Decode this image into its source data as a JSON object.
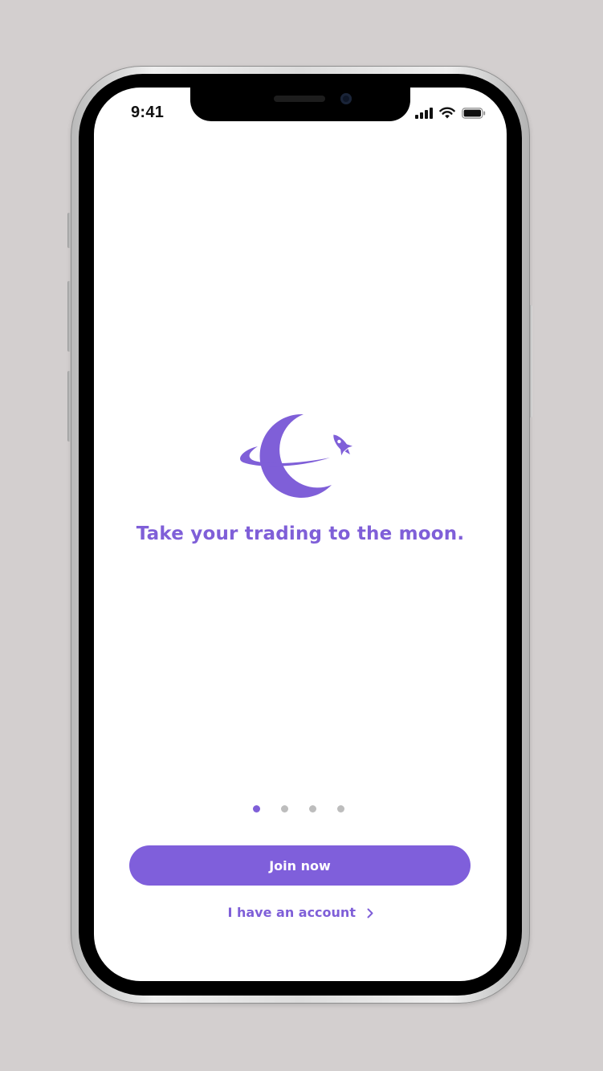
{
  "status_bar": {
    "time": "9:41",
    "icons": [
      "signal-icon",
      "wifi-icon",
      "battery-icon"
    ]
  },
  "onboarding": {
    "logo": "planet-rocket-logo",
    "tagline": "Take your trading to the moon.",
    "pager": {
      "total": 4,
      "active": 1
    },
    "join_label": "Join now",
    "account_label": "I have an account",
    "account_icon": "chevron-right-icon"
  },
  "colors": {
    "accent": "#7f5fd8",
    "button": "#7f5fdb",
    "background": "#ffffff",
    "page_bg": "#d3cfcf",
    "dot_inactive": "#bdbdbd"
  }
}
